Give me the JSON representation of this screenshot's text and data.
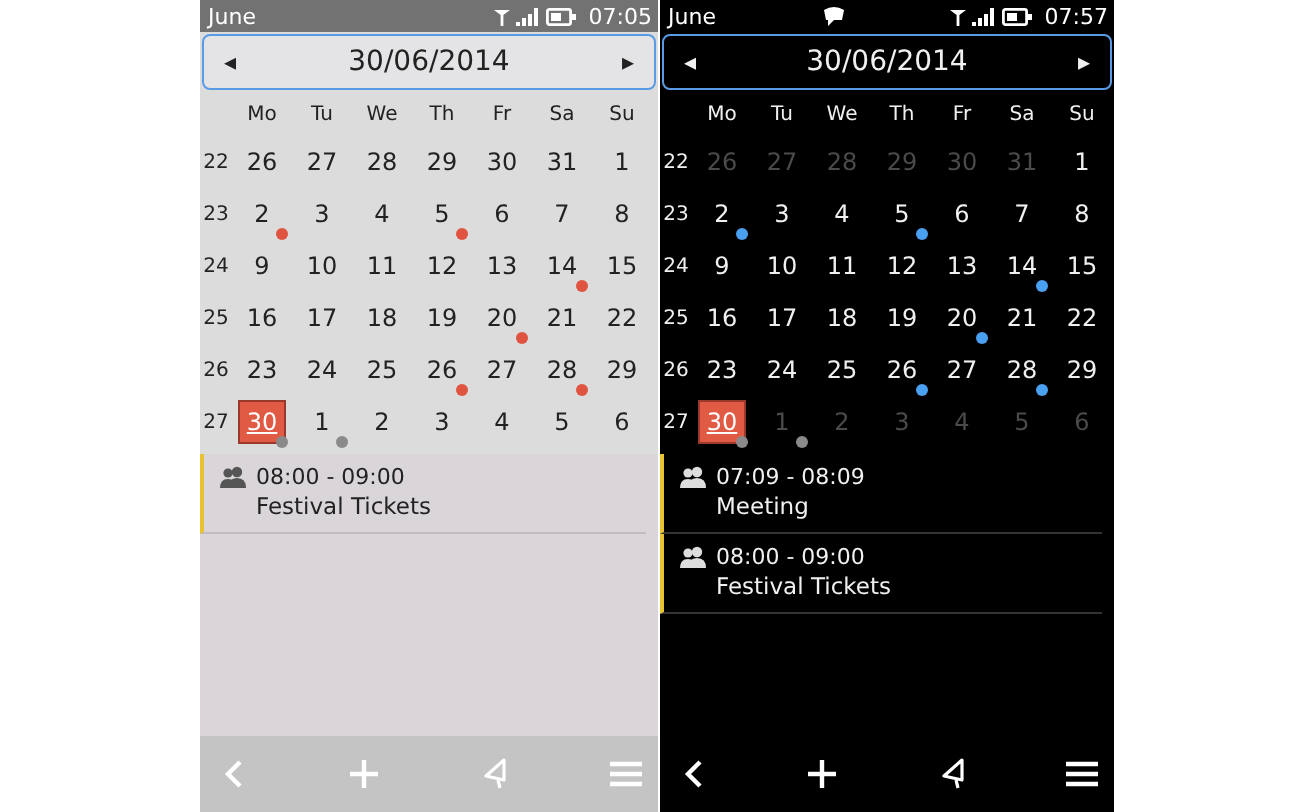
{
  "phones": [
    {
      "kind": "light",
      "status_bar": {
        "title": "June",
        "notification": false,
        "time": "07:05"
      },
      "date_header": {
        "prev": "◂",
        "date": "30/06/2014",
        "next": "▸"
      },
      "weekdays": [
        "Mo",
        "Tu",
        "We",
        "Th",
        "Fr",
        "Sa",
        "Su"
      ],
      "weeks": [
        {
          "number": "22",
          "days": [
            {
              "text": "26",
              "muted": false,
              "selected": false
            },
            {
              "text": "27",
              "muted": false,
              "selected": false
            },
            {
              "text": "28",
              "muted": false,
              "selected": false
            },
            {
              "text": "29",
              "muted": false,
              "selected": false
            },
            {
              "text": "30",
              "muted": false,
              "selected": false
            },
            {
              "text": "31",
              "muted": false,
              "selected": false
            },
            {
              "text": "1",
              "muted": false,
              "selected": false
            }
          ]
        },
        {
          "number": "23",
          "days": [
            {
              "text": "2",
              "muted": false,
              "selected": false,
              "color": "#e0533f"
            },
            {
              "text": "3",
              "muted": false,
              "selected": false
            },
            {
              "text": "4",
              "muted": false,
              "selected": false
            },
            {
              "text": "5",
              "muted": false,
              "selected": false,
              "color": "#e0533f"
            },
            {
              "text": "6",
              "muted": false,
              "selected": false
            },
            {
              "text": "7",
              "muted": false,
              "selected": false
            },
            {
              "text": "8",
              "muted": false,
              "selected": false
            }
          ]
        },
        {
          "number": "24",
          "days": [
            {
              "text": "9",
              "muted": false,
              "selected": false
            },
            {
              "text": "10",
              "muted": false,
              "selected": false
            },
            {
              "text": "11",
              "muted": false,
              "selected": false
            },
            {
              "text": "12",
              "muted": false,
              "selected": false
            },
            {
              "text": "13",
              "muted": false,
              "selected": false
            },
            {
              "text": "14",
              "muted": false,
              "selected": false,
              "color": "#e0533f"
            },
            {
              "text": "15",
              "muted": false,
              "selected": false
            }
          ]
        },
        {
          "number": "25",
          "days": [
            {
              "text": "16",
              "muted": false,
              "selected": false
            },
            {
              "text": "17",
              "muted": false,
              "selected": false
            },
            {
              "text": "18",
              "muted": false,
              "selected": false
            },
            {
              "text": "19",
              "muted": false,
              "selected": false
            },
            {
              "text": "20",
              "muted": false,
              "selected": false,
              "color": "#e0533f"
            },
            {
              "text": "21",
              "muted": false,
              "selected": false
            },
            {
              "text": "22",
              "muted": false,
              "selected": false
            }
          ]
        },
        {
          "number": "26",
          "days": [
            {
              "text": "23",
              "muted": false,
              "selected": false
            },
            {
              "text": "24",
              "muted": false,
              "selected": false
            },
            {
              "text": "25",
              "muted": false,
              "selected": false
            },
            {
              "text": "26",
              "muted": false,
              "selected": false,
              "color": "#e0533f"
            },
            {
              "text": "27",
              "muted": false,
              "selected": false
            },
            {
              "text": "28",
              "muted": false,
              "selected": false,
              "color": "#e0533f"
            },
            {
              "text": "29",
              "muted": false,
              "selected": false
            }
          ]
        },
        {
          "number": "27",
          "days": [
            {
              "text": "30",
              "muted": false,
              "selected": true,
              "color": "#8a8a8a"
            },
            {
              "text": "1",
              "muted": false,
              "selected": false,
              "color": "#8a8a8a"
            },
            {
              "text": "2",
              "muted": false,
              "selected": false
            },
            {
              "text": "3",
              "muted": false,
              "selected": false
            },
            {
              "text": "4",
              "muted": false,
              "selected": false
            },
            {
              "text": "5",
              "muted": false,
              "selected": false
            },
            {
              "text": "6",
              "muted": false,
              "selected": false
            }
          ]
        }
      ],
      "events": [
        {
          "time": "08:00 - 09:00",
          "title": "Festival Tickets"
        }
      ]
    },
    {
      "kind": "dark",
      "status_bar": {
        "title": "June",
        "notification": true,
        "time": "07:57"
      },
      "date_header": {
        "prev": "◂",
        "date": "30/06/2014",
        "next": "▸"
      },
      "weekdays": [
        "Mo",
        "Tu",
        "We",
        "Th",
        "Fr",
        "Sa",
        "Su"
      ],
      "weeks": [
        {
          "number": "22",
          "days": [
            {
              "text": "26",
              "muted": true,
              "selected": false
            },
            {
              "text": "27",
              "muted": true,
              "selected": false
            },
            {
              "text": "28",
              "muted": true,
              "selected": false
            },
            {
              "text": "29",
              "muted": true,
              "selected": false
            },
            {
              "text": "30",
              "muted": true,
              "selected": false
            },
            {
              "text": "31",
              "muted": true,
              "selected": false
            },
            {
              "text": "1",
              "muted": false,
              "selected": false
            }
          ]
        },
        {
          "number": "23",
          "days": [
            {
              "text": "2",
              "muted": false,
              "selected": false,
              "color": "#4a9ff0"
            },
            {
              "text": "3",
              "muted": false,
              "selected": false
            },
            {
              "text": "4",
              "muted": false,
              "selected": false
            },
            {
              "text": "5",
              "muted": false,
              "selected": false,
              "color": "#4a9ff0"
            },
            {
              "text": "6",
              "muted": false,
              "selected": false
            },
            {
              "text": "7",
              "muted": false,
              "selected": false
            },
            {
              "text": "8",
              "muted": false,
              "selected": false
            }
          ]
        },
        {
          "number": "24",
          "days": [
            {
              "text": "9",
              "muted": false,
              "selected": false
            },
            {
              "text": "10",
              "muted": false,
              "selected": false
            },
            {
              "text": "11",
              "muted": false,
              "selected": false
            },
            {
              "text": "12",
              "muted": false,
              "selected": false
            },
            {
              "text": "13",
              "muted": false,
              "selected": false
            },
            {
              "text": "14",
              "muted": false,
              "selected": false,
              "color": "#4a9ff0"
            },
            {
              "text": "15",
              "muted": false,
              "selected": false
            }
          ]
        },
        {
          "number": "25",
          "days": [
            {
              "text": "16",
              "muted": false,
              "selected": false
            },
            {
              "text": "17",
              "muted": false,
              "selected": false
            },
            {
              "text": "18",
              "muted": false,
              "selected": false
            },
            {
              "text": "19",
              "muted": false,
              "selected": false
            },
            {
              "text": "20",
              "muted": false,
              "selected": false,
              "color": "#4a9ff0"
            },
            {
              "text": "21",
              "muted": false,
              "selected": false
            },
            {
              "text": "22",
              "muted": false,
              "selected": false
            }
          ]
        },
        {
          "number": "26",
          "days": [
            {
              "text": "23",
              "muted": false,
              "selected": false
            },
            {
              "text": "24",
              "muted": false,
              "selected": false
            },
            {
              "text": "25",
              "muted": false,
              "selected": false
            },
            {
              "text": "26",
              "muted": false,
              "selected": false,
              "color": "#4a9ff0"
            },
            {
              "text": "27",
              "muted": false,
              "selected": false
            },
            {
              "text": "28",
              "muted": false,
              "selected": false,
              "color": "#4a9ff0"
            },
            {
              "text": "29",
              "muted": false,
              "selected": false
            }
          ]
        },
        {
          "number": "27",
          "days": [
            {
              "text": "30",
              "muted": false,
              "selected": true,
              "color": "#8a8a8a"
            },
            {
              "text": "1",
              "muted": true,
              "selected": false,
              "color": "#8a8a8a"
            },
            {
              "text": "2",
              "muted": true,
              "selected": false
            },
            {
              "text": "3",
              "muted": true,
              "selected": false
            },
            {
              "text": "4",
              "muted": true,
              "selected": false
            },
            {
              "text": "5",
              "muted": true,
              "selected": false
            },
            {
              "text": "6",
              "muted": true,
              "selected": false
            }
          ]
        }
      ],
      "events": [
        {
          "time": "07:09 - 08:09",
          "title": "Meeting"
        },
        {
          "time": "08:00 - 09:00",
          "title": "Festival Tickets"
        }
      ]
    }
  ]
}
